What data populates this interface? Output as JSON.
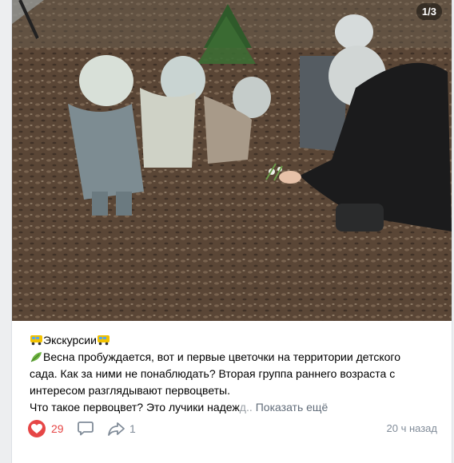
{
  "photo": {
    "counter": "1/3"
  },
  "post": {
    "title": "Экскурсии",
    "line1": "Весна пробуждается, вот и первые цветочки на территории детского",
    "line2": "сада. Как за ними не понаблюдать? Вторая группа раннего возраста с",
    "line3": "интересом разглядывают первоцветы.",
    "line4_visible": "Что такое первоцвет? Это лучики надеж",
    "line4_faded": "д..",
    "show_more": "Показать ещё"
  },
  "actions": {
    "likes": "29",
    "shares": "1",
    "timestamp": "20 ч назад",
    "like_color": "#e64646"
  },
  "icons": [
    "bus-icon",
    "leaf-icon",
    "heart-icon",
    "comment-icon",
    "share-icon"
  ]
}
